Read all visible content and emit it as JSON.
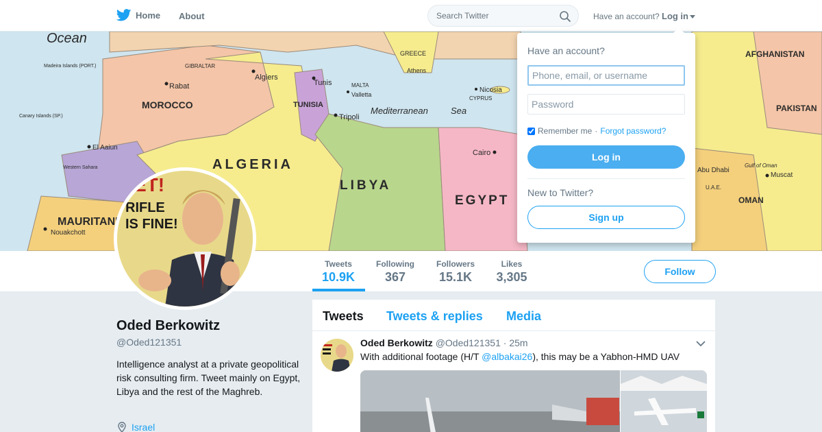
{
  "nav": {
    "home_label": "Home",
    "about_label": "About",
    "search_placeholder": "Search Twitter",
    "have_account": "Have an account?",
    "login_label": "Log in"
  },
  "banner": {
    "map_labels": [
      {
        "text": "Ocean",
        "size": "big"
      },
      {
        "text": "ALGERIA",
        "size": "country"
      },
      {
        "text": "LIBYA",
        "size": "country"
      },
      {
        "text": "EGYPT",
        "size": "country"
      },
      {
        "text": "MOROCCO",
        "size": "mid"
      },
      {
        "text": "TUNISIA",
        "size": "small"
      },
      {
        "text": "MAURITANIA",
        "size": "mid"
      },
      {
        "text": "Mediterranean",
        "size": "sea"
      },
      {
        "text": "Sea",
        "size": "sea"
      },
      {
        "text": "AFGHANISTAN",
        "size": "mid"
      },
      {
        "text": "PAKISTAN",
        "size": "mid"
      },
      {
        "text": "OMAN",
        "size": "small"
      },
      {
        "text": "Rabat",
        "size": "city"
      },
      {
        "text": "Algiers",
        "size": "city"
      },
      {
        "text": "Tunis",
        "size": "city"
      },
      {
        "text": "Tripoli",
        "size": "city"
      },
      {
        "text": "Cairo",
        "size": "city"
      },
      {
        "text": "Nouakchott",
        "size": "city"
      },
      {
        "text": "El Aaiun",
        "size": "city"
      },
      {
        "text": "Muscat",
        "size": "city"
      },
      {
        "text": "GIBRALTAR",
        "size": "tiny"
      },
      {
        "text": "MALTA",
        "size": "tiny"
      },
      {
        "text": "Valletta",
        "size": "city"
      },
      {
        "text": "Nicosia",
        "size": "city"
      },
      {
        "text": "CYPRUS",
        "size": "tiny"
      },
      {
        "text": "GREECE",
        "size": "tiny"
      },
      {
        "text": "Athens",
        "size": "city"
      },
      {
        "text": "Abu Dhabi",
        "size": "city"
      },
      {
        "text": "U.A.E.",
        "size": "tiny"
      },
      {
        "text": "Gulf of Oman",
        "size": "tiny"
      },
      {
        "text": "Canary Islands (SP.)",
        "size": "tiny"
      },
      {
        "text": "Madeira Islands (PORT.)",
        "size": "tiny"
      },
      {
        "text": "Western Sahara",
        "size": "tiny"
      }
    ]
  },
  "stats": [
    {
      "label": "Tweets",
      "value": "10.9K",
      "active": true
    },
    {
      "label": "Following",
      "value": "367",
      "active": false
    },
    {
      "label": "Followers",
      "value": "15.1K",
      "active": false
    },
    {
      "label": "Likes",
      "value": "3,305",
      "active": false
    }
  ],
  "follow_label": "Follow",
  "profile": {
    "name": "Oded Berkowitz",
    "handle": "@Oded121351",
    "bio": "Intelligence analyst at a private geopolitical risk consulting firm. Tweet mainly on Egypt, Libya and the rest of the Maghreb.",
    "location": "Israel",
    "avatar_text_1": "ET!",
    "avatar_text_2": "RIFLE",
    "avatar_text_3": "IS FINE!"
  },
  "timeline": {
    "tabs": [
      "Tweets",
      "Tweets & replies",
      "Media"
    ],
    "tweet": {
      "name": "Oded Berkowitz",
      "handle": "@Oded121351",
      "time": "25m",
      "text_before": "With additional footage (H/T ",
      "mention": "@albakai26",
      "text_after": "), this may be a Yabhon-HMD UAV"
    }
  },
  "login_dropdown": {
    "title": "Have an account?",
    "username_placeholder": "Phone, email, or username",
    "password_placeholder": "Password",
    "remember": "Remember me",
    "separator": "·",
    "forgot": "Forgot password?",
    "login_button": "Log in",
    "new_to_twitter": "New to Twitter?",
    "signup_button": "Sign up"
  },
  "colors": {
    "accent": "#1da1f2",
    "login_button": "#4aaef0",
    "text_primary": "#14171a",
    "text_secondary": "#657786",
    "page_bg": "#e6ecf0"
  }
}
